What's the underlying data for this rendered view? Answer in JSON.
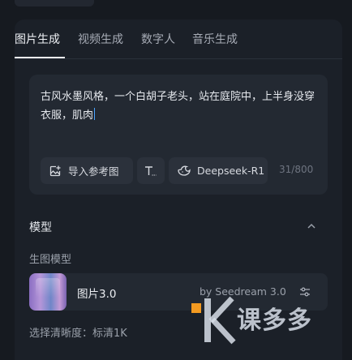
{
  "tabs": [
    {
      "label": "图片生成",
      "active": true
    },
    {
      "label": "视频生成",
      "active": false
    },
    {
      "label": "数字人",
      "active": false
    },
    {
      "label": "音乐生成",
      "active": false
    }
  ],
  "prompt": {
    "text": "古风水墨风格，一个白胡子老头，站在庭院中，上半身没穿衣服，肌肉",
    "char_count": "31/800"
  },
  "toolbar": {
    "import_label": "导入参考图",
    "model_label": "Deepseek-R1"
  },
  "model_section": {
    "title": "模型",
    "sub_label": "生图模型",
    "model_name": "图片3.0",
    "model_by": "by Seedream 3.0"
  },
  "resolution_label": "选择清晰度：标清1K",
  "watermark": {
    "text": "课多多"
  },
  "colors": {
    "background": "#161a20",
    "panel": "#1b2028",
    "input": "#232932",
    "chip": "#2b313b",
    "caret": "#4aa3ff",
    "watermark_accent": "#f39a21"
  }
}
